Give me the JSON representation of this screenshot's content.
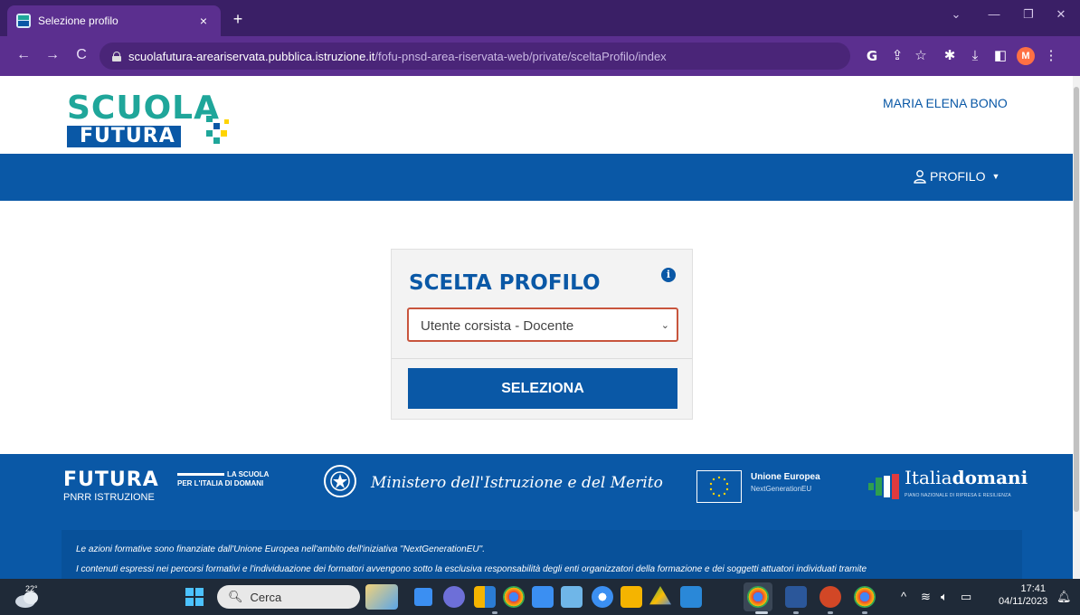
{
  "browser": {
    "tab_title": "Selezione profilo",
    "tab_close": "×",
    "new_tab": "+",
    "url_host": "scuolafutura-areariservata.pubblica.istruzione.it",
    "url_path": "/fofu-pnsd-area-riservata-web/private/sceltaProfilo/index",
    "profile_initial": "M",
    "accent_color": "#5b2f8f"
  },
  "header": {
    "logo_top": "SCUOLA",
    "logo_bottom": "FUTURA",
    "user_name": "MARIA ELENA BONO"
  },
  "navbar": {
    "profile_menu": "PROFILO"
  },
  "profile_card": {
    "title": "SCELTA PROFILO",
    "selected_profile": "Utente corsista - Docente",
    "select_button": "SELEZIONA"
  },
  "footer": {
    "futura": "FUTURA",
    "tagline_1": "LA SCUOLA",
    "tagline_2": "PER L'ITALIA DI DOMANI",
    "pnrr": "PNRR ISTRUZIONE",
    "ministero": "Ministero dell'Istruzione e del Merito",
    "eu_title": "Unione Europea",
    "eu_sub": "NextGenerationEU",
    "italia_light": "Italia",
    "italia_bold": "domani",
    "italia_sub": "PIANO NAZIONALE DI RIPRESA E RESILIENZA",
    "notice_1": "Le azioni formative sono finanziate dall'Unione Europea nell'ambito dell'iniziativa \"NextGenerationEU\".",
    "notice_2": "I contenuti espressi nei percorsi formativi e l'individuazione dei formatori avvengono sotto la esclusiva responsabilità degli enti organizzatori della formazione e dei soggetti attuatori individuati tramite"
  },
  "taskbar": {
    "temperature": "22°",
    "search_label": "Cerca",
    "time": "17:41",
    "date": "04/11/2023"
  }
}
